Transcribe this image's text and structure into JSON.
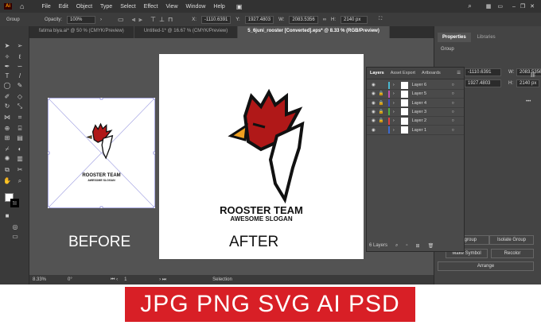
{
  "app": {
    "logo": "Ai"
  },
  "menu": [
    "File",
    "Edit",
    "Object",
    "Type",
    "Select",
    "Effect",
    "View",
    "Window",
    "Help"
  ],
  "control": {
    "selection_type": "Group",
    "opacity_label": "Opacity:",
    "opacity": "100%",
    "x_label": "X:",
    "x": "-1110.6391",
    "y_label": "Y:",
    "y": "1927.4803",
    "w_label": "W:",
    "w": "2083.5356",
    "h_label": "H:",
    "h": "2140 px"
  },
  "tabs": [
    "fatima biya.ai* @ 50 % (CMYK/Preview)",
    "Untitled-1* @ 16.67 % (CMYK/Preview)",
    "5_6juni_rooster [Converted].eps* @ 8.33 % (RGB/Preview)"
  ],
  "properties": {
    "tabs": [
      "Properties",
      "Libraries"
    ],
    "group": "Group",
    "x": "-1110.6391",
    "y": "1927.4803",
    "w_label": "W:",
    "w": "2083.5356",
    "h_label": "H:",
    "h": "2140 px",
    "buttons": [
      "Ungroup",
      "Isolate Group",
      "Make Symbol",
      "Recolor",
      "Arrange"
    ]
  },
  "layers_panel": {
    "tabs": [
      "Layers",
      "Asset Export",
      "Artboards"
    ],
    "layers": [
      {
        "name": "Layer 6",
        "color": "#4ab8d0"
      },
      {
        "name": "Layer 5",
        "color": "#c050b0"
      },
      {
        "name": "Layer 4",
        "color": "#3c4fc0"
      },
      {
        "name": "Layer 3",
        "color": "#4fb040"
      },
      {
        "name": "Layer 2",
        "color": "#e04040"
      },
      {
        "name": "Layer 1",
        "color": "#3c6ad0"
      }
    ],
    "count": "6 Layers"
  },
  "status": {
    "zoom": "8.33%",
    "rotation": "0°",
    "artboard": "1",
    "tool": "Selection"
  },
  "artwork": {
    "brand": "ROOSTER TEAM",
    "slogan": "AWESOME SLOGAN"
  },
  "captions": {
    "before": "BEFORE",
    "after": "AFTER"
  },
  "banner": "JPG PNG SVG AI PSD"
}
